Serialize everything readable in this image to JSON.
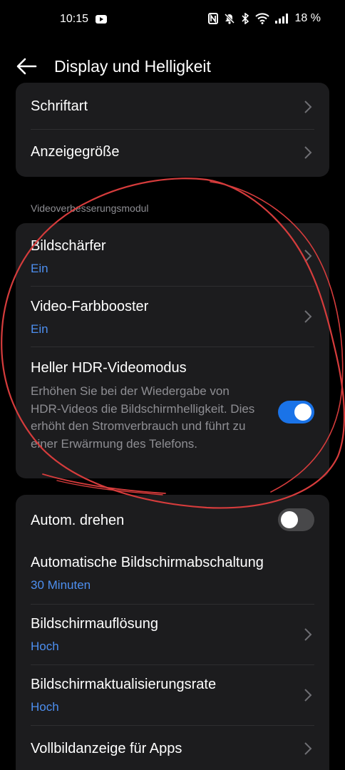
{
  "status_bar": {
    "time": "10:15",
    "battery": "18 %",
    "icons": [
      "youtube-icon",
      "nfc-icon",
      "mute-icon",
      "bluetooth-icon",
      "wifi-icon",
      "signal-icon"
    ]
  },
  "app_bar": {
    "title": "Display und Helligkeit",
    "back_icon": "arrow-left-icon"
  },
  "group1": {
    "items": [
      {
        "title": "Schriftart"
      },
      {
        "title": "Anzeigegröße"
      }
    ]
  },
  "section_video": {
    "label": "Videoverbesserungsmodul",
    "items": [
      {
        "title": "Bildschärfer",
        "value": "Ein"
      },
      {
        "title": "Video-Farbbooster",
        "value": "Ein"
      },
      {
        "title": "Heller HDR-Videomodus",
        "description": "Erhöhen Sie bei der Wiedergabe von HDR-Videos die Bildschirmhelligkeit. Dies erhöht den Stromverbrauch und führt zu einer Erwärmung des Telefons.",
        "toggle": "on"
      }
    ]
  },
  "group3": {
    "items": [
      {
        "title": "Autom. drehen",
        "toggle": "off"
      },
      {
        "title": "Automatische Bildschirmabschaltung",
        "value": "30 Minuten"
      },
      {
        "title": "Bildschirmauflösung",
        "value": "Hoch"
      },
      {
        "title": "Bildschirmaktualisierungsrate",
        "value": "Hoch"
      },
      {
        "title": "Vollbildanzeige für Apps"
      }
    ]
  },
  "colors": {
    "background": "#000000",
    "card": "#1c1c1e",
    "accent": "#4d8ff0",
    "toggle_on": "#1a73e8",
    "annotation": "#d63c3c"
  }
}
